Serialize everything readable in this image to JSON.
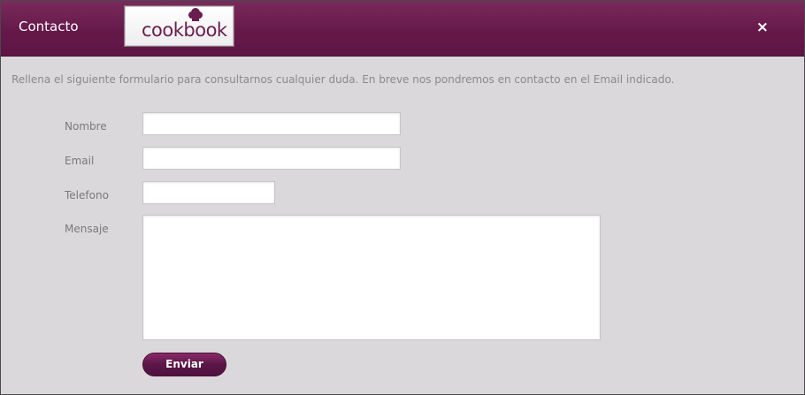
{
  "dialog": {
    "title": "Contacto",
    "close_label": "×",
    "logo": {
      "word_prefix": "cook",
      "word_suffix": "book",
      "icon": "chef-hat-icon"
    }
  },
  "form": {
    "intro": "Rellena el siguiente formulario para consultarnos cualquier duda. En breve nos pondremos en contacto en el Email indicado.",
    "labels": {
      "name": "Nombre",
      "email": "Email",
      "phone": "Telefono",
      "message": "Mensaje"
    },
    "values": {
      "name": "",
      "email": "",
      "phone": "",
      "message": ""
    },
    "submit_label": "Enviar"
  },
  "colors": {
    "brand": "#65194a",
    "background": "#dad8da",
    "label": "#7a7a7a"
  }
}
